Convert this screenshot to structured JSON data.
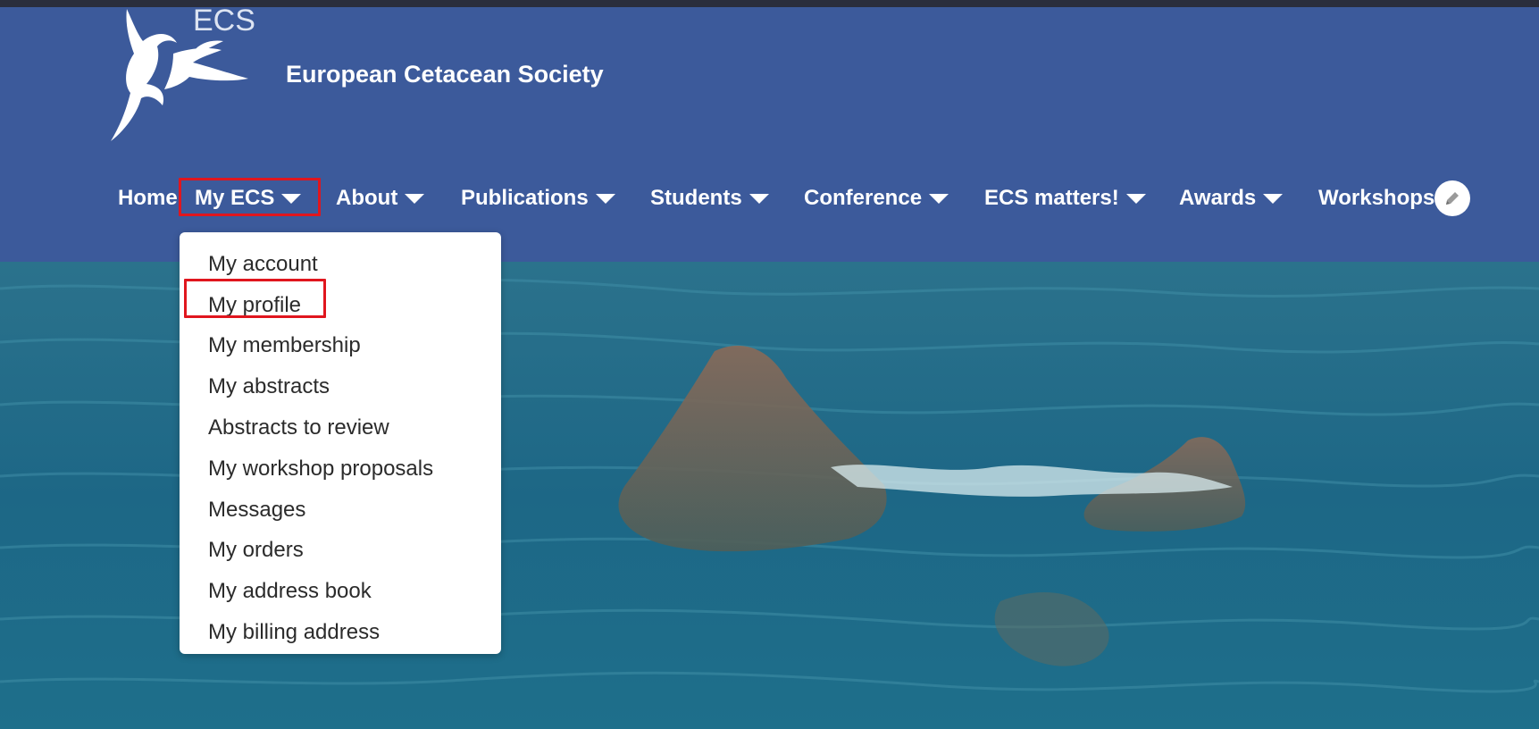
{
  "header": {
    "logo_abbr": "ECS",
    "site_name": "European Cetacean Society"
  },
  "nav": {
    "items": [
      {
        "label": "Home",
        "has_caret": false
      },
      {
        "label": "My ECS",
        "has_caret": true,
        "highlighted": true
      },
      {
        "label": "About",
        "has_caret": true
      },
      {
        "label": "Publications",
        "has_caret": true
      },
      {
        "label": "Students",
        "has_caret": true
      },
      {
        "label": "Conference",
        "has_caret": true
      },
      {
        "label": "ECS matters!",
        "has_caret": true
      },
      {
        "label": "Awards",
        "has_caret": true
      },
      {
        "label": "Workshops",
        "has_caret": false
      }
    ],
    "edit_icon": "pencil-icon"
  },
  "dropdown": {
    "items": [
      {
        "label": "My account"
      },
      {
        "label": "My profile",
        "highlighted": true
      },
      {
        "label": "My membership"
      },
      {
        "label": "My abstracts"
      },
      {
        "label": "Abstracts to review"
      },
      {
        "label": "My workshop proposals"
      },
      {
        "label": "Messages"
      },
      {
        "label": "My orders"
      },
      {
        "label": "My address book"
      },
      {
        "label": "My billing address"
      }
    ]
  },
  "colors": {
    "header_bg": "#3c5a9b",
    "highlight": "#e0161e",
    "sea": "#1e6a8a"
  }
}
